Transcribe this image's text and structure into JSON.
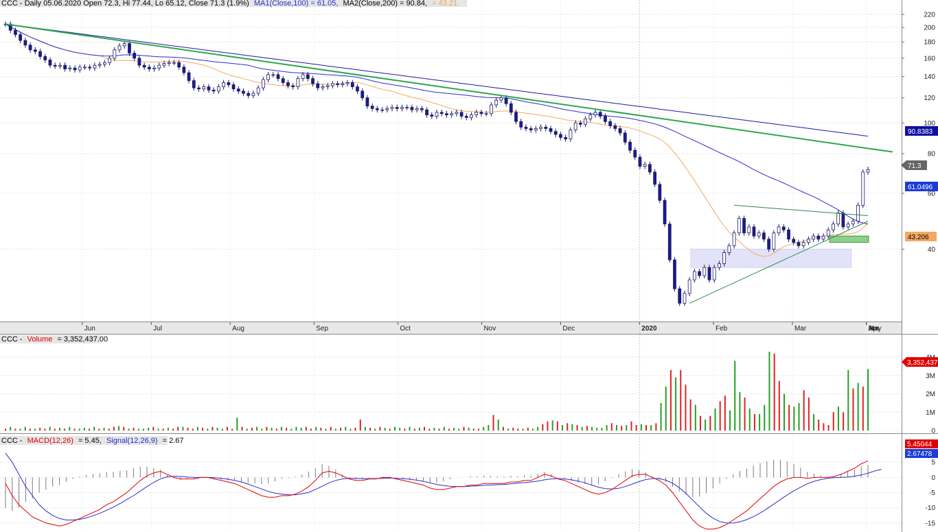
{
  "chart_data": {
    "type": "candlestick",
    "symbol": "CCC",
    "title_prefix": "CCC - Daily 05.06.2020 Open 72.3, Hi 77.44, Lo 65.12, Close 71.3 (1.9%)",
    "ma1_label": "MA1(Close,100) = 61.05,",
    "ma2_label": "MA2(Close,200) = 90.84,",
    "ma3_label": "= 43.21",
    "months": [
      "Jun",
      "Jul",
      "Aug",
      "Sep",
      "Oct",
      "Nov",
      "Dec",
      "2020",
      "Feb",
      "Mar",
      "Apr",
      "May",
      "Jun"
    ],
    "price_axis": {
      "scale": "log",
      "ticks": [
        220,
        200,
        180,
        160,
        140,
        120,
        100,
        80,
        60,
        40
      ],
      "range": [
        24,
        230
      ]
    },
    "closes": [
      205,
      196,
      190,
      182,
      176,
      170,
      168,
      162,
      158,
      152,
      151,
      152,
      148,
      149,
      147,
      150,
      150,
      149,
      152,
      153,
      155,
      160,
      170,
      175,
      178,
      166,
      160,
      152,
      150,
      148,
      149,
      152,
      154,
      155,
      155,
      150,
      144,
      136,
      129,
      128,
      130,
      127,
      126,
      130,
      134,
      132,
      128,
      126,
      124,
      122,
      124,
      129,
      137,
      142,
      142,
      138,
      134,
      131,
      130,
      138,
      142,
      138,
      133,
      129,
      130,
      131,
      133,
      132,
      133,
      134,
      130,
      126,
      120,
      113,
      111,
      110,
      110,
      111,
      112,
      111,
      112,
      112,
      110,
      111,
      110,
      106,
      105,
      108,
      107,
      106,
      107,
      108,
      105,
      104,
      106,
      108,
      107,
      107,
      114,
      118,
      120,
      115,
      108,
      101,
      97,
      96,
      95,
      96,
      97,
      96,
      94,
      92,
      90,
      89,
      95,
      100,
      99,
      103,
      106,
      108,
      105,
      101,
      98,
      96,
      93,
      87,
      82,
      78,
      73,
      74,
      70,
      64,
      57,
      48,
      37,
      30,
      27,
      29,
      32,
      34,
      33,
      35,
      32,
      35,
      36,
      39,
      41,
      45,
      50,
      45,
      47,
      44,
      45,
      43,
      40,
      45,
      47,
      46,
      43,
      42,
      41,
      42,
      43,
      44,
      43,
      44,
      46,
      48,
      52,
      47,
      48,
      49,
      55,
      70,
      71.3
    ],
    "ma1_label_tag": "61.0496",
    "ma2_label_tag": "90.8383",
    "ma3_label_tag": "43.206",
    "close_tag": "71.3",
    "volume": {
      "label_prefix": "CCC -",
      "label_name": "Volume",
      "label_value": "= 3,352,437.00",
      "ticks": [
        "4M",
        "3M",
        "2M",
        "1M",
        "0"
      ],
      "tick_values": [
        4,
        3,
        2,
        1,
        0
      ],
      "max": 4.6,
      "last_tag": "3,352,437",
      "values_m": [
        0.1,
        0.2,
        0.1,
        0.1,
        0.2,
        0.1,
        0.1,
        0.15,
        0.1,
        0.2,
        0.1,
        0.15,
        0.1,
        0.2,
        0.1,
        0.1,
        0.15,
        0.1,
        0.2,
        0.1,
        0.15,
        0.1,
        0.2,
        0.25,
        0.2,
        0.1,
        0.15,
        0.1,
        0.1,
        0.15,
        0.2,
        0.1,
        0.1,
        0.15,
        0.1,
        0.2,
        0.2,
        0.15,
        0.1,
        0.2,
        0.15,
        0.1,
        0.2,
        0.15,
        0.1,
        0.2,
        0.1,
        0.7,
        0.2,
        0.1,
        0.15,
        0.2,
        0.1,
        0.2,
        0.15,
        0.1,
        0.2,
        0.15,
        0.1,
        0.2,
        0.15,
        0.2,
        0.1,
        0.2,
        0.15,
        0.1,
        0.2,
        0.1,
        0.15,
        0.2,
        0.1,
        0.15,
        0.6,
        0.2,
        0.15,
        0.1,
        0.2,
        0.15,
        0.1,
        0.2,
        0.15,
        0.1,
        0.2,
        0.1,
        0.15,
        0.2,
        0.1,
        0.15,
        0.1,
        0.2,
        0.1,
        0.15,
        0.1,
        0.2,
        0.15,
        0.1,
        0.1,
        0.2,
        0.3,
        0.85,
        0.6,
        0.2,
        0.1,
        0.15,
        0.1,
        0.1,
        0.15,
        0.1,
        0.2,
        0.35,
        0.5,
        0.55,
        0.5,
        0.3,
        0.4,
        0.35,
        0.3,
        0.2,
        0.25,
        0.2,
        0.15,
        0.15,
        0.3,
        0.4,
        0.3,
        0.25,
        0.3,
        0.5,
        0.3,
        0.35,
        0.3,
        0.3,
        0.4,
        1.5,
        2.4,
        3.3,
        2.9,
        3.3,
        2.5,
        1.7,
        1.4,
        0.8,
        0.6,
        0.8,
        1.2,
        1.6,
        1.9,
        1.1,
        3.8,
        2.1,
        1.8,
        1.2,
        0.9,
        0.9,
        1.4,
        4.3,
        4.2,
        2.7,
        2.0,
        1.4,
        1.3,
        1.5,
        2.2,
        1.8,
        0.9,
        0.6,
        0.4,
        0.3,
        1.0,
        1.3,
        1.0,
        3.3,
        2.3,
        2.6,
        2.4,
        3.35
      ],
      "up_flags": "rgrggrgrrgrgrgrggrgrgrrgrgrgggrgrgrrgrrgrgrggrrgrgrggrgrgrgggrrgrgrgrggrrgrgrgrggrgrgrrgrgrggrgrrggrgrgrrgrggrrgrgrgrgrggggrgrgrrgrgrggrgrrrgrgrgrrgggrgrgggrrgrggrrgrrrrgrgrgrggrrrgrgrgrgr"
    },
    "macd": {
      "label_prefix": "CCC -",
      "label_macd": "MACD(12,26)",
      "label_rest": "= 5.45,",
      "label_signal": "Signal(12,26,9)",
      "label_signal_value": "= 2.67",
      "ticks": [
        "5",
        "0",
        "-5",
        "-10",
        "-15"
      ],
      "tick_values": [
        5,
        0,
        -5,
        -10,
        -15
      ],
      "range": [
        -17.5,
        10
      ],
      "macd_tag": "5.45044",
      "signal_tag": "2.67478",
      "macd_values": [
        -2,
        -6,
        -9,
        -11,
        -13,
        -14,
        -15,
        -15.5,
        -16,
        -15.5,
        -14.5,
        -13.5,
        -12.5,
        -11.5,
        -10.5,
        -9,
        -8,
        -6.5,
        -5,
        -3,
        -1,
        0.5,
        1.5,
        2,
        1,
        0,
        -0.5,
        -0.5,
        -0.5,
        0,
        0,
        -0.5,
        -1,
        -1.5,
        -2,
        -3,
        -4,
        -5,
        -6,
        -6.5,
        -6.5,
        -6,
        -6,
        -5.5,
        -4.5,
        -3,
        -1,
        1.5,
        2,
        1.5,
        0.5,
        -0.5,
        -1,
        -1,
        -0.5,
        -0.5,
        0,
        0,
        -0.5,
        -1,
        -1.5,
        -2,
        -2.5,
        -3.5,
        -4,
        -4,
        -3.5,
        -3,
        -3,
        -2.5,
        -2.5,
        -2,
        -2,
        -2,
        -2,
        -1.5,
        -1.5,
        -1,
        -1,
        0,
        1,
        0.5,
        -0.5,
        -1,
        -2,
        -3,
        -4,
        -5,
        -5.5,
        -5,
        -4,
        -2.5,
        -1,
        0.5,
        1,
        1,
        0,
        -1,
        -2.5,
        -5,
        -8,
        -11,
        -14,
        -16,
        -17,
        -17,
        -16.5,
        -15.5,
        -14,
        -12.5,
        -11,
        -9,
        -7,
        -5,
        -3,
        -1.5,
        -0.5,
        0,
        0,
        -0.3,
        0,
        0,
        0,
        0.3,
        1,
        2,
        3,
        4.5,
        5.45
      ],
      "signal_values": [
        8,
        5,
        1,
        -3,
        -6,
        -9,
        -11,
        -12.5,
        -13.5,
        -14,
        -14,
        -13.8,
        -13.3,
        -12.6,
        -11.8,
        -10.8,
        -9.8,
        -8.6,
        -7.3,
        -6,
        -4.5,
        -3,
        -1.6,
        -0.5,
        0.2,
        0.4,
        0.3,
        0.1,
        0,
        0,
        0,
        -0.1,
        -0.3,
        -0.6,
        -1,
        -1.5,
        -2.2,
        -3,
        -3.8,
        -4.6,
        -5.2,
        -5.5,
        -5.7,
        -5.7,
        -5.4,
        -4.9,
        -4,
        -2.9,
        -1.8,
        -1,
        -0.5,
        -0.3,
        -0.3,
        -0.4,
        -0.4,
        -0.4,
        -0.3,
        -0.2,
        -0.3,
        -0.4,
        -0.6,
        -0.9,
        -1.3,
        -1.8,
        -2.3,
        -2.7,
        -2.9,
        -3,
        -3,
        -2.9,
        -2.8,
        -2.6,
        -2.5,
        -2.4,
        -2.3,
        -2.1,
        -1.9,
        -1.7,
        -1.5,
        -1.2,
        -0.8,
        -0.5,
        -0.4,
        -0.5,
        -0.8,
        -1.2,
        -1.8,
        -2.5,
        -3.2,
        -3.7,
        -3.8,
        -3.6,
        -3,
        -2.2,
        -1.4,
        -0.7,
        -0.4,
        -0.4,
        -0.9,
        -1.9,
        -3.4,
        -5.3,
        -7.5,
        -9.7,
        -11.8,
        -13.4,
        -14.5,
        -15,
        -15,
        -14.6,
        -13.9,
        -12.9,
        -11.7,
        -10.3,
        -8.8,
        -7.3,
        -5.8,
        -4.4,
        -3.2,
        -2.1,
        -1.3,
        -0.7,
        -0.3,
        -0.1,
        0,
        0.1,
        0.4,
        0.8,
        1.4,
        2.1,
        2.67
      ]
    }
  }
}
